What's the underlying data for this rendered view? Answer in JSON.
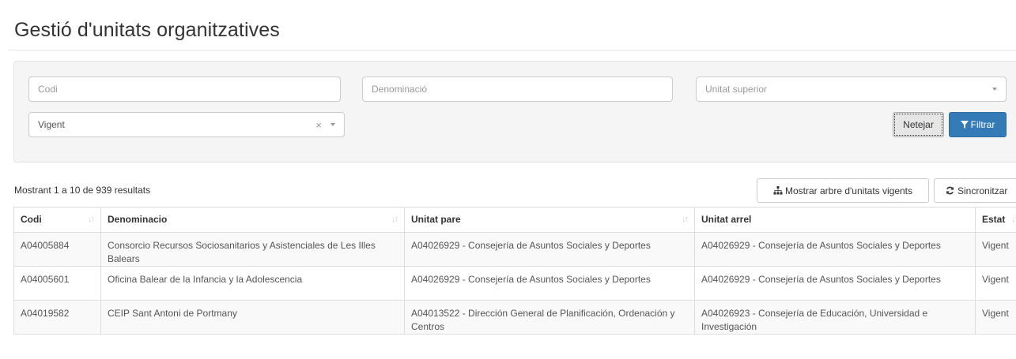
{
  "page": {
    "title": "Gestió d'unitats organitzatives"
  },
  "filters": {
    "codi_placeholder": "Codi",
    "denominacio_placeholder": "Denominació",
    "unitat_superior_placeholder": "Unitat superior",
    "estat_value": "Vigent",
    "clear_symbol": "×",
    "netejar_label": "Netejar",
    "filtrar_label": "Filtrar"
  },
  "toolbar": {
    "results_text": "Mostrant 1 a 10 de 939 resultats",
    "tree_button_label": "Mostrar arbre d'unitats vigents",
    "sync_button_label": "Sincronitzar"
  },
  "table": {
    "columns": [
      "Codi",
      "Denominacio",
      "Unitat pare",
      "Unitat arrel",
      "Estat"
    ],
    "rows": [
      {
        "codi": "A04005884",
        "denominacio": "Consorcio Recursos Sociosanitarios y Asistenciales de Les Illes Balears",
        "unitat_pare": "A04026929 - Consejería de Asuntos Sociales y Deportes",
        "unitat_arrel": "A04026929 - Consejería de Asuntos Sociales y Deportes",
        "estat": "Vigent"
      },
      {
        "codi": "A04005601",
        "denominacio": "Oficina Balear de la Infancia y la Adolescencia",
        "unitat_pare": "A04026929 - Consejería de Asuntos Sociales y Deportes",
        "unitat_arrel": "A04026929 - Consejería de Asuntos Sociales y Deportes",
        "estat": "Vigent"
      },
      {
        "codi": "A04019582",
        "denominacio": "CEIP Sant Antoni de Portmany",
        "unitat_pare": "A04013522 - Dirección General de Planificación, Ordenación y Centros",
        "unitat_arrel": "A04026923 - Consejería de Educación, Universidad e Investigación",
        "estat": "Vigent"
      }
    ]
  },
  "colors": {
    "primary": "#337ab7",
    "panel_bg": "#f5f5f5",
    "stripe": "#f9f9f9"
  },
  "icons": {
    "filter": "filter-icon",
    "sitemap": "sitemap-icon",
    "refresh": "refresh-icon",
    "sort": "sort-icon",
    "caret": "caret-down-icon"
  }
}
